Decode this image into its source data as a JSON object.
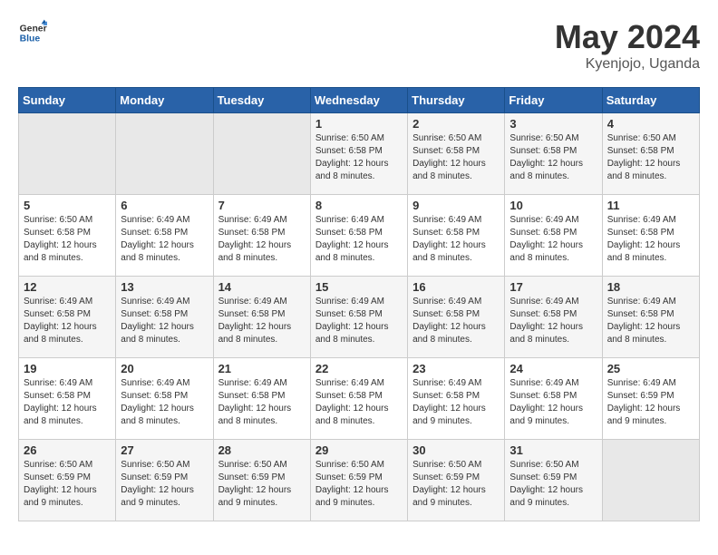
{
  "header": {
    "logo_general": "General",
    "logo_blue": "Blue",
    "month_title": "May 2024",
    "location": "Kyenjojo, Uganda"
  },
  "days_of_week": [
    "Sunday",
    "Monday",
    "Tuesday",
    "Wednesday",
    "Thursday",
    "Friday",
    "Saturday"
  ],
  "weeks": [
    {
      "row": 1,
      "days": [
        {
          "num": "",
          "sunrise": "",
          "sunset": "",
          "daylight": "",
          "empty": true
        },
        {
          "num": "",
          "sunrise": "",
          "sunset": "",
          "daylight": "",
          "empty": true
        },
        {
          "num": "",
          "sunrise": "",
          "sunset": "",
          "daylight": "",
          "empty": true
        },
        {
          "num": "1",
          "sunrise": "Sunrise: 6:50 AM",
          "sunset": "Sunset: 6:58 PM",
          "daylight": "Daylight: 12 hours and 8 minutes.",
          "empty": false
        },
        {
          "num": "2",
          "sunrise": "Sunrise: 6:50 AM",
          "sunset": "Sunset: 6:58 PM",
          "daylight": "Daylight: 12 hours and 8 minutes.",
          "empty": false
        },
        {
          "num": "3",
          "sunrise": "Sunrise: 6:50 AM",
          "sunset": "Sunset: 6:58 PM",
          "daylight": "Daylight: 12 hours and 8 minutes.",
          "empty": false
        },
        {
          "num": "4",
          "sunrise": "Sunrise: 6:50 AM",
          "sunset": "Sunset: 6:58 PM",
          "daylight": "Daylight: 12 hours and 8 minutes.",
          "empty": false
        }
      ]
    },
    {
      "row": 2,
      "days": [
        {
          "num": "5",
          "sunrise": "Sunrise: 6:50 AM",
          "sunset": "Sunset: 6:58 PM",
          "daylight": "Daylight: 12 hours and 8 minutes.",
          "empty": false
        },
        {
          "num": "6",
          "sunrise": "Sunrise: 6:49 AM",
          "sunset": "Sunset: 6:58 PM",
          "daylight": "Daylight: 12 hours and 8 minutes.",
          "empty": false
        },
        {
          "num": "7",
          "sunrise": "Sunrise: 6:49 AM",
          "sunset": "Sunset: 6:58 PM",
          "daylight": "Daylight: 12 hours and 8 minutes.",
          "empty": false
        },
        {
          "num": "8",
          "sunrise": "Sunrise: 6:49 AM",
          "sunset": "Sunset: 6:58 PM",
          "daylight": "Daylight: 12 hours and 8 minutes.",
          "empty": false
        },
        {
          "num": "9",
          "sunrise": "Sunrise: 6:49 AM",
          "sunset": "Sunset: 6:58 PM",
          "daylight": "Daylight: 12 hours and 8 minutes.",
          "empty": false
        },
        {
          "num": "10",
          "sunrise": "Sunrise: 6:49 AM",
          "sunset": "Sunset: 6:58 PM",
          "daylight": "Daylight: 12 hours and 8 minutes.",
          "empty": false
        },
        {
          "num": "11",
          "sunrise": "Sunrise: 6:49 AM",
          "sunset": "Sunset: 6:58 PM",
          "daylight": "Daylight: 12 hours and 8 minutes.",
          "empty": false
        }
      ]
    },
    {
      "row": 3,
      "days": [
        {
          "num": "12",
          "sunrise": "Sunrise: 6:49 AM",
          "sunset": "Sunset: 6:58 PM",
          "daylight": "Daylight: 12 hours and 8 minutes.",
          "empty": false
        },
        {
          "num": "13",
          "sunrise": "Sunrise: 6:49 AM",
          "sunset": "Sunset: 6:58 PM",
          "daylight": "Daylight: 12 hours and 8 minutes.",
          "empty": false
        },
        {
          "num": "14",
          "sunrise": "Sunrise: 6:49 AM",
          "sunset": "Sunset: 6:58 PM",
          "daylight": "Daylight: 12 hours and 8 minutes.",
          "empty": false
        },
        {
          "num": "15",
          "sunrise": "Sunrise: 6:49 AM",
          "sunset": "Sunset: 6:58 PM",
          "daylight": "Daylight: 12 hours and 8 minutes.",
          "empty": false
        },
        {
          "num": "16",
          "sunrise": "Sunrise: 6:49 AM",
          "sunset": "Sunset: 6:58 PM",
          "daylight": "Daylight: 12 hours and 8 minutes.",
          "empty": false
        },
        {
          "num": "17",
          "sunrise": "Sunrise: 6:49 AM",
          "sunset": "Sunset: 6:58 PM",
          "daylight": "Daylight: 12 hours and 8 minutes.",
          "empty": false
        },
        {
          "num": "18",
          "sunrise": "Sunrise: 6:49 AM",
          "sunset": "Sunset: 6:58 PM",
          "daylight": "Daylight: 12 hours and 8 minutes.",
          "empty": false
        }
      ]
    },
    {
      "row": 4,
      "days": [
        {
          "num": "19",
          "sunrise": "Sunrise: 6:49 AM",
          "sunset": "Sunset: 6:58 PM",
          "daylight": "Daylight: 12 hours and 8 minutes.",
          "empty": false
        },
        {
          "num": "20",
          "sunrise": "Sunrise: 6:49 AM",
          "sunset": "Sunset: 6:58 PM",
          "daylight": "Daylight: 12 hours and 8 minutes.",
          "empty": false
        },
        {
          "num": "21",
          "sunrise": "Sunrise: 6:49 AM",
          "sunset": "Sunset: 6:58 PM",
          "daylight": "Daylight: 12 hours and 8 minutes.",
          "empty": false
        },
        {
          "num": "22",
          "sunrise": "Sunrise: 6:49 AM",
          "sunset": "Sunset: 6:58 PM",
          "daylight": "Daylight: 12 hours and 8 minutes.",
          "empty": false
        },
        {
          "num": "23",
          "sunrise": "Sunrise: 6:49 AM",
          "sunset": "Sunset: 6:58 PM",
          "daylight": "Daylight: 12 hours and 9 minutes.",
          "empty": false
        },
        {
          "num": "24",
          "sunrise": "Sunrise: 6:49 AM",
          "sunset": "Sunset: 6:58 PM",
          "daylight": "Daylight: 12 hours and 9 minutes.",
          "empty": false
        },
        {
          "num": "25",
          "sunrise": "Sunrise: 6:49 AM",
          "sunset": "Sunset: 6:59 PM",
          "daylight": "Daylight: 12 hours and 9 minutes.",
          "empty": false
        }
      ]
    },
    {
      "row": 5,
      "days": [
        {
          "num": "26",
          "sunrise": "Sunrise: 6:50 AM",
          "sunset": "Sunset: 6:59 PM",
          "daylight": "Daylight: 12 hours and 9 minutes.",
          "empty": false
        },
        {
          "num": "27",
          "sunrise": "Sunrise: 6:50 AM",
          "sunset": "Sunset: 6:59 PM",
          "daylight": "Daylight: 12 hours and 9 minutes.",
          "empty": false
        },
        {
          "num": "28",
          "sunrise": "Sunrise: 6:50 AM",
          "sunset": "Sunset: 6:59 PM",
          "daylight": "Daylight: 12 hours and 9 minutes.",
          "empty": false
        },
        {
          "num": "29",
          "sunrise": "Sunrise: 6:50 AM",
          "sunset": "Sunset: 6:59 PM",
          "daylight": "Daylight: 12 hours and 9 minutes.",
          "empty": false
        },
        {
          "num": "30",
          "sunrise": "Sunrise: 6:50 AM",
          "sunset": "Sunset: 6:59 PM",
          "daylight": "Daylight: 12 hours and 9 minutes.",
          "empty": false
        },
        {
          "num": "31",
          "sunrise": "Sunrise: 6:50 AM",
          "sunset": "Sunset: 6:59 PM",
          "daylight": "Daylight: 12 hours and 9 minutes.",
          "empty": false
        },
        {
          "num": "",
          "sunrise": "",
          "sunset": "",
          "daylight": "",
          "empty": true
        }
      ]
    }
  ]
}
